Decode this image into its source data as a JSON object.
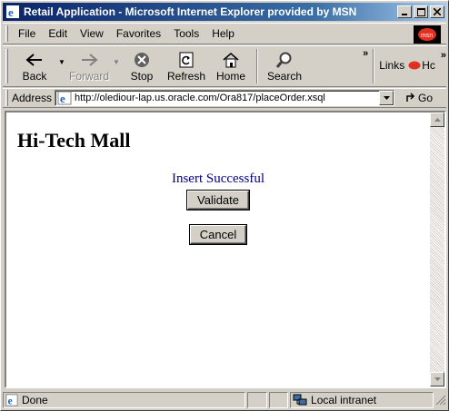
{
  "window": {
    "title": "Retail Application - Microsoft Internet Explorer provided by MSN"
  },
  "menu": {
    "items": [
      {
        "label": "File"
      },
      {
        "label": "Edit"
      },
      {
        "label": "View"
      },
      {
        "label": "Favorites"
      },
      {
        "label": "Tools"
      },
      {
        "label": "Help"
      }
    ]
  },
  "toolbar": {
    "back_label": "Back",
    "forward_label": "Forward",
    "stop_label": "Stop",
    "refresh_label": "Refresh",
    "home_label": "Home",
    "search_label": "Search",
    "links_label": "Links",
    "links_item": "Hc"
  },
  "address": {
    "label": "Address",
    "url": "http://olediour-lap.us.oracle.com/Ora817/placeOrder.xsql",
    "go_label": "Go"
  },
  "page": {
    "title": "Hi-Tech Mall",
    "message": "Insert Successful",
    "validate_label": "Validate",
    "cancel_label": "Cancel"
  },
  "status": {
    "text": "Done",
    "zone": "Local intranet"
  },
  "colors": {
    "title_gradient_start": "#0a246a",
    "message_text": "#000080",
    "chrome": "#d4d0c8"
  }
}
